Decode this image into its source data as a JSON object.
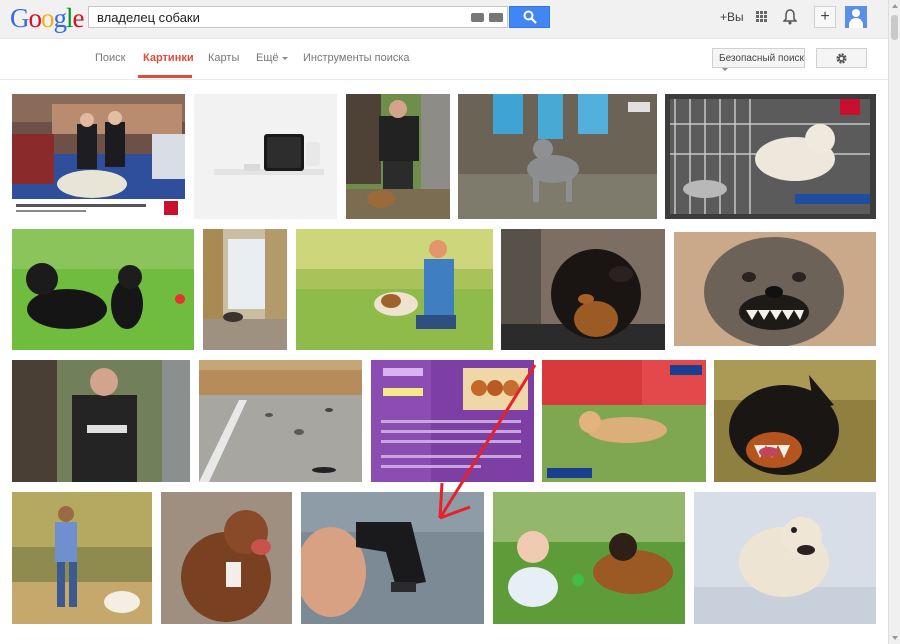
{
  "header": {
    "logo": [
      "G",
      "o",
      "o",
      "g",
      "l",
      "e"
    ],
    "logo_colors": [
      "#3369e8",
      "#d50f25",
      "#eeb211",
      "#3369e8",
      "#009925",
      "#d50f25"
    ],
    "search_query": "владелец собаки",
    "plus_you": "+Вы"
  },
  "nav": {
    "tabs": [
      {
        "label": "Поиск",
        "active": false
      },
      {
        "label": "Картинки",
        "active": true
      },
      {
        "label": "Карты",
        "active": false
      },
      {
        "label": "Ещё",
        "active": false
      },
      {
        "label": "Инструменты поиска",
        "active": false
      }
    ],
    "safe_search_label": "Безопасный поиск"
  },
  "colors": {
    "accent": "#dd4b39",
    "search_blue": "#4285f4",
    "annotation_arrow": "#e8202a"
  },
  "results": [
    {
      "desc": "dog show ring with long-corded white dog and people"
    },
    {
      "desc": "white product box on shelf"
    },
    {
      "desc": "man in black shirt with small dog"
    },
    {
      "desc": "grey dog with blue chairs"
    },
    {
      "desc": "white dog in cage with bowl"
    },
    {
      "desc": "two black cane corso dogs on grass"
    },
    {
      "desc": "room with window and dog"
    },
    {
      "desc": "woman playing with beagle on grass"
    },
    {
      "desc": "rottweiler in car window"
    },
    {
      "desc": "snarling grey dog"
    },
    {
      "desc": "man in black shirt outdoors"
    },
    {
      "desc": "pigeons on asphalt yard"
    },
    {
      "desc": "purple book page with puppies"
    },
    {
      "desc": "dog lying on grass, TV screenshot"
    },
    {
      "desc": "snarling doberman"
    },
    {
      "desc": "woman walking white dog"
    },
    {
      "desc": "brown pit bull sitting"
    },
    {
      "desc": "hand holding gun in pocket"
    },
    {
      "desc": "child with german shepherd"
    },
    {
      "desc": "white dog running in snow"
    }
  ]
}
